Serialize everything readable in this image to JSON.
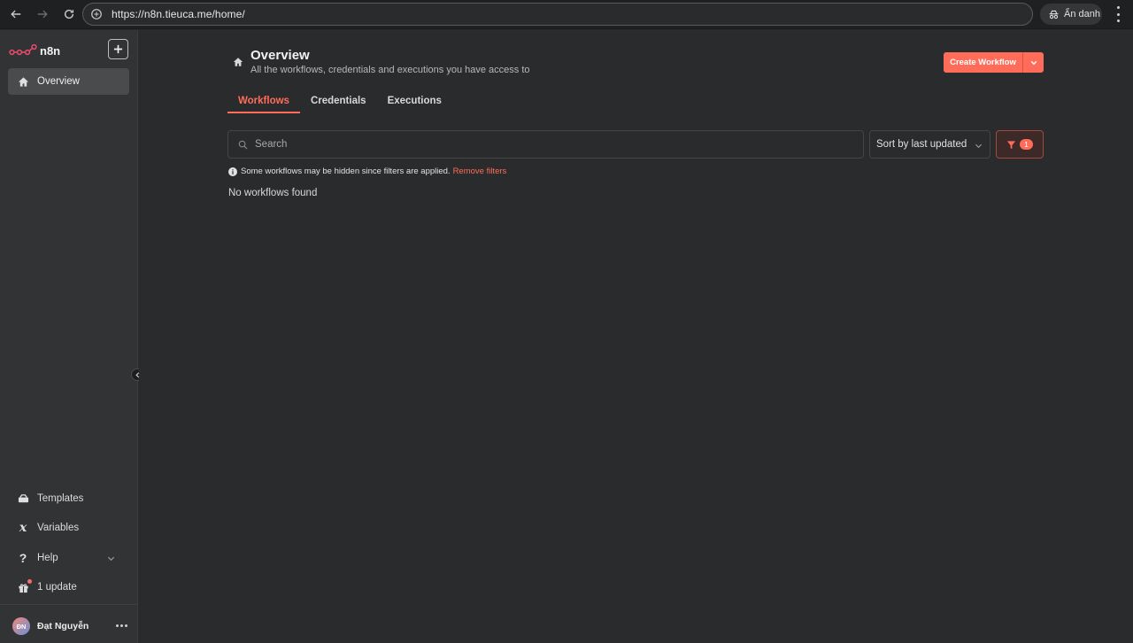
{
  "browser": {
    "url": "https://n8n.tieuca.me/home/",
    "incognito_label": "Ẩn danh"
  },
  "sidebar": {
    "logo_text": "n8n",
    "items": [
      {
        "label": "Overview",
        "icon": "home-icon"
      }
    ],
    "bottom_items": [
      {
        "label": "Templates",
        "icon": "templates-icon"
      },
      {
        "label": "Variables",
        "icon": "variables-icon"
      },
      {
        "label": "Help",
        "icon": "help-icon"
      },
      {
        "label": "1 update",
        "icon": "gift-icon"
      }
    ],
    "user": {
      "initials": "ĐN",
      "name": "Đạt Nguyễn"
    }
  },
  "main": {
    "title": "Overview",
    "subtitle": "All the workflows, credentials and executions you have access to",
    "create_button": "Create Workflow",
    "tabs": [
      {
        "label": "Workflows",
        "active": true
      },
      {
        "label": "Credentials",
        "active": false
      },
      {
        "label": "Executions",
        "active": false
      }
    ],
    "search": {
      "placeholder": "Search",
      "value": ""
    },
    "sort": {
      "selected": "Sort by last updated"
    },
    "filter": {
      "count": "1"
    },
    "notice": {
      "text": "Some workflows may be hidden since filters are applied.",
      "link": "Remove filters"
    },
    "empty_text": "No workflows found"
  },
  "colors": {
    "accent": "#ff6d5a",
    "sidebar_bg": "#323334",
    "main_bg": "#2a2b2c"
  }
}
